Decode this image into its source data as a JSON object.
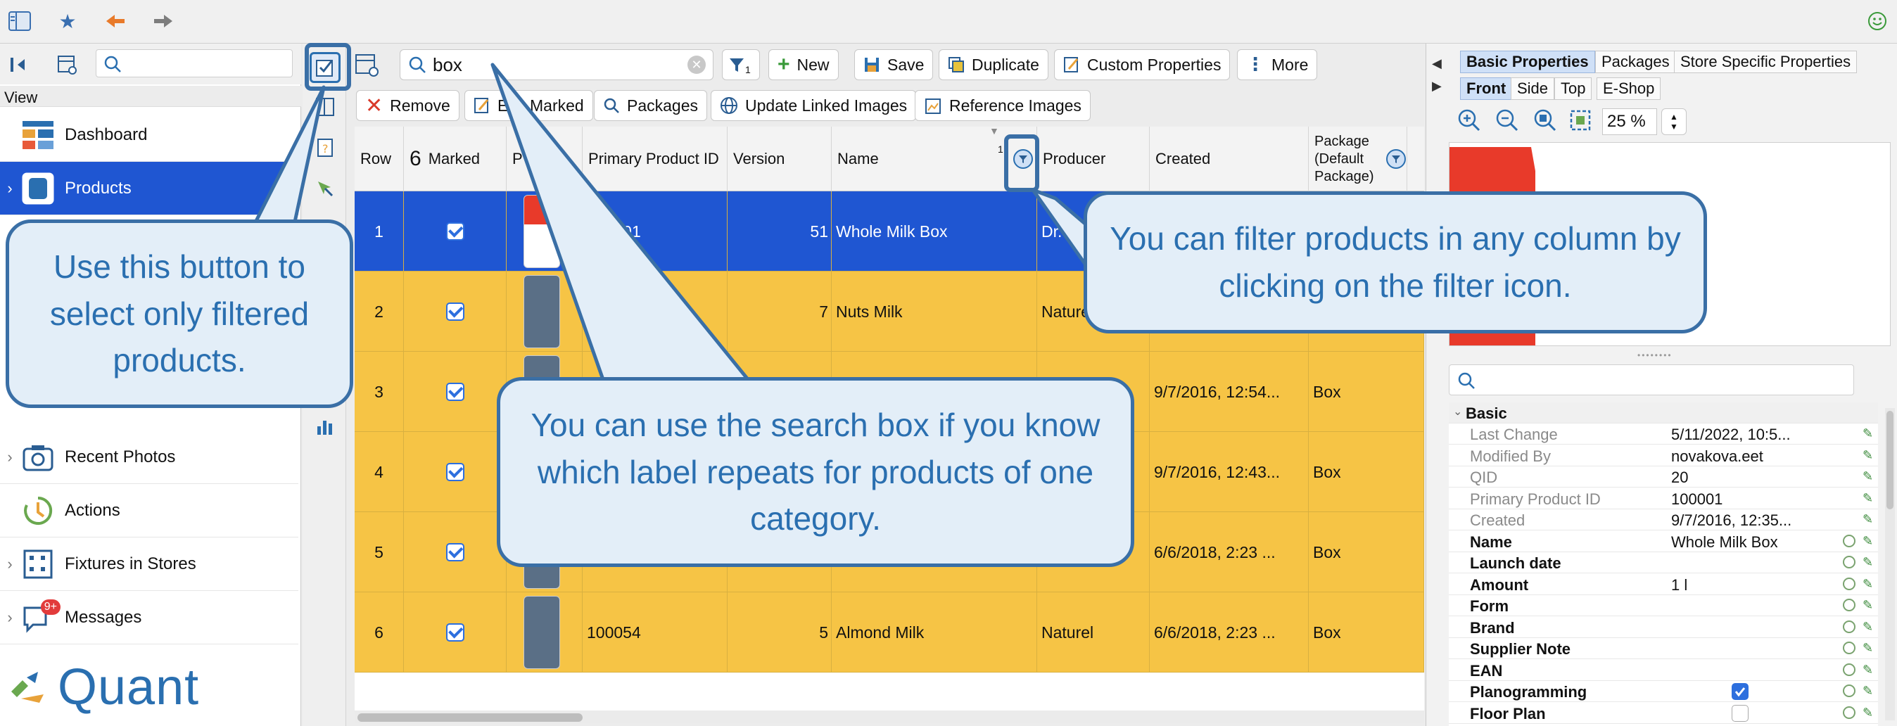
{
  "toolbar_top": {
    "icons": [
      "sidebar-toggle-icon",
      "star-icon",
      "back-arrow-icon",
      "forward-arrow-icon",
      "smiley-icon"
    ]
  },
  "sidebar": {
    "search_placeholder": "",
    "view_label": "View",
    "items": [
      {
        "label": "Dashboard",
        "icon": "dashboard-icon",
        "expandable": false,
        "selected": false
      },
      {
        "label": "Products",
        "icon": "products-icon",
        "expandable": true,
        "selected": true
      },
      {
        "label": "Recent Photos",
        "icon": "camera-icon",
        "expandable": true,
        "selected": false
      },
      {
        "label": "Actions",
        "icon": "actions-icon",
        "expandable": false,
        "selected": false
      },
      {
        "label": "Fixtures in Stores",
        "icon": "fixtures-icon",
        "expandable": true,
        "selected": false
      },
      {
        "label": "Messages",
        "icon": "messages-icon",
        "expandable": true,
        "selected": false,
        "badge": "9+"
      }
    ],
    "brand": "Quant"
  },
  "toolbar": {
    "search_value": "box",
    "filter_count": "1",
    "new": "New",
    "save": "Save",
    "duplicate": "Duplicate",
    "custom_properties": "Custom Properties",
    "more": "More",
    "remove": "Remove",
    "edit_marked": "Edit Marked",
    "packages": "Packages",
    "update_linked_images": "Update Linked Images",
    "reference_images": "Reference Images"
  },
  "grid": {
    "columns": [
      "Row",
      "Marked",
      "P",
      "Primary Product ID",
      "Version",
      "Name",
      "Producer",
      "Created",
      "Package (Default Package)"
    ],
    "name_sort_indicator": "1",
    "rows": [
      {
        "row": "1",
        "marked": true,
        "ppid": "100001",
        "version": "51",
        "name": "Whole Milk Box",
        "producer": "Dr. …",
        "created": "",
        "package": "",
        "selected": true
      },
      {
        "row": "2",
        "marked": true,
        "ppid": "",
        "version": "7",
        "name": "Nuts Milk",
        "producer": "Naturel",
        "created": "",
        "package": "",
        "selected": false
      },
      {
        "row": "3",
        "marked": true,
        "ppid": "",
        "version": "",
        "name": "",
        "producer": "",
        "created": "9/7/2016, 12:54...",
        "package": "Box",
        "selected": false
      },
      {
        "row": "4",
        "marked": true,
        "ppid": "",
        "version": "",
        "name": "",
        "producer": "",
        "created": "9/7/2016, 12:43...",
        "package": "Box",
        "selected": false
      },
      {
        "row": "5",
        "marked": true,
        "ppid": "",
        "version": "",
        "name": "",
        "producer": "",
        "created": "6/6/2018, 2:23 ...",
        "package": "Box",
        "selected": false
      },
      {
        "row": "6",
        "marked": true,
        "ppid": "100054",
        "version": "5",
        "name": "Almond Milk",
        "producer": "Naturel",
        "created": "6/6/2018, 2:23 ...",
        "package": "Box",
        "selected": false
      }
    ]
  },
  "right_panel": {
    "tabs": [
      "Basic Properties",
      "Packages",
      "Store Specific Properties"
    ],
    "view_tabs": [
      "Front",
      "Side",
      "Top",
      "E-Shop"
    ],
    "zoom": "25 %",
    "section": "Basic",
    "properties": [
      {
        "key": "Last Change",
        "value": "5/11/2022, 10:5...",
        "style": "gray"
      },
      {
        "key": "Modified By",
        "value": "novakova.eet",
        "style": "gray"
      },
      {
        "key": "QID",
        "value": "20",
        "style": "gray"
      },
      {
        "key": "Primary Product ID",
        "value": "100001",
        "style": "gray"
      },
      {
        "key": "Created",
        "value": "9/7/2016, 12:35...",
        "style": "gray"
      },
      {
        "key": "Name",
        "value": "Whole Milk Box",
        "style": "bold"
      },
      {
        "key": "Launch date",
        "value": "",
        "style": "bold"
      },
      {
        "key": "Amount",
        "value": "1 l",
        "style": "bold"
      },
      {
        "key": "Form",
        "value": "",
        "style": "bold"
      },
      {
        "key": "Brand",
        "value": "",
        "style": "bold"
      },
      {
        "key": "Supplier Note",
        "value": "",
        "style": "bold"
      },
      {
        "key": "EAN",
        "value": "",
        "style": "bold"
      },
      {
        "key": "Planogramming",
        "value": "",
        "style": "bold",
        "checkbox": true
      },
      {
        "key": "Floor Plan",
        "value": "",
        "style": "bold",
        "checkbox": false
      }
    ]
  },
  "callouts": {
    "select_filtered": "Use this button to select only filtered products.",
    "filter_icon": "You can filter products in any column by clicking on the filter icon.",
    "search_box": "You can use the search box if you know which label repeats for products of one category."
  },
  "colors": {
    "selected_row": "#1f56d2",
    "marked_row": "#f6c445",
    "callout_border": "#3a6fa6",
    "callout_fill": "#e3eef8",
    "callout_text": "#2a6fb0"
  }
}
